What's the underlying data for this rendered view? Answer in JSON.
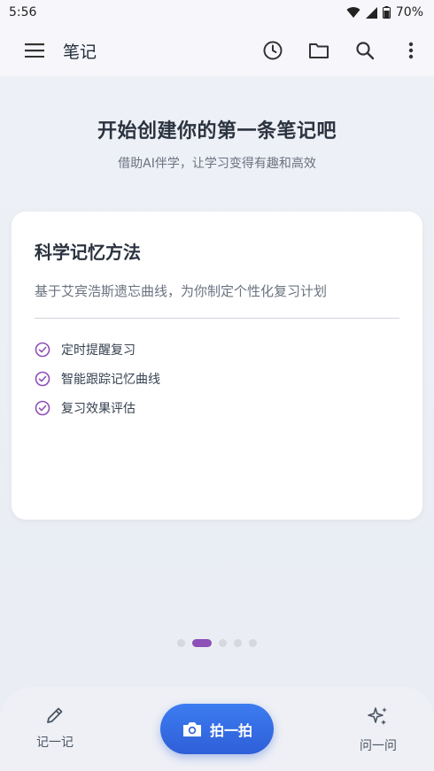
{
  "status_bar": {
    "time": "5:56",
    "battery": "70%"
  },
  "app_bar": {
    "title": "笔记"
  },
  "hero": {
    "title": "开始创建你的第一条笔记吧",
    "subtitle": "借助AI伴学，让学习变得有趣和高效"
  },
  "card": {
    "title": "科学记忆方法",
    "description": "基于艾宾浩斯遗忘曲线，为你制定个性化复习计划",
    "features": [
      "定时提醒复习",
      "智能跟踪记忆曲线",
      "复习效果评估"
    ]
  },
  "pager": {
    "total": 5,
    "active_index": 1
  },
  "bottom_nav": {
    "write_label": "记一记",
    "capture_label": "拍一拍",
    "ask_label": "问一问"
  },
  "colors": {
    "accent_purple": "#8e4fb7",
    "primary_blue": "#2f5fd8"
  },
  "icons": [
    "menu-icon",
    "history-icon",
    "folder-icon",
    "search-icon",
    "more-vert-icon",
    "check-circle-icon",
    "pencil-icon",
    "camera-icon",
    "sparkle-icon"
  ]
}
